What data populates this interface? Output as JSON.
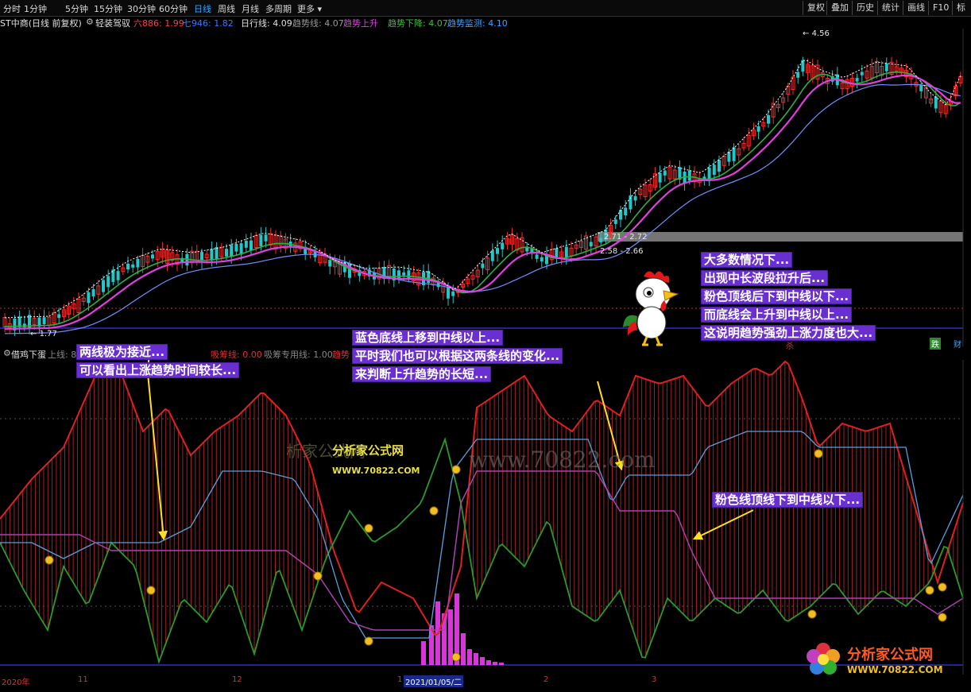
{
  "toolbar": {
    "periods": [
      "分时",
      "1分钟",
      "5分钟",
      "15分钟",
      "30分钟",
      "60分钟",
      "日线",
      "周线",
      "月线",
      "多周期",
      "更多"
    ],
    "active_period": "日线",
    "right_buttons": [
      "复权",
      "叠加",
      "历史",
      "统计",
      "画线",
      "F10",
      "标"
    ]
  },
  "main_info": {
    "stock": "ST中商(日线 前复权)",
    "indicator": "轻装驾驭",
    "six_label": "六886: 1.99",
    "seven_label": "七946: 1.82",
    "day_line": "日行线: 4.09",
    "trend_line": "趋势线: 4.07",
    "trend_up": "趋势上升",
    "trend_down": "趋势下降: 4.07",
    "trend_monitor": "趋势监测: 4.10"
  },
  "price_labels": {
    "high": "4.56",
    "low": "1.77",
    "range1": "2.71 - 2.72",
    "range2": "2.58 - 2.66"
  },
  "sub_info": {
    "name": "借鸡下蛋",
    "upper": "上线: 80",
    "collect": "吸筹线: 0.00",
    "collect_special": "吸筹专用线: 1.00",
    "trend": "趋势"
  },
  "side_labels": {
    "kill": "杀",
    "flat": "跌",
    "wealth": "财"
  },
  "notes": {
    "right_top": [
      "大多数情况下...",
      "出现中长波段拉升后...",
      "粉色顶线后下到中线以下...",
      "而底线会上升到中线以上...",
      "这说明趋势强劲上涨力度也大..."
    ],
    "left": [
      "两线极为接近...",
      "可以看出上涨趋势时间较长..."
    ],
    "middle": [
      "蓝色底线上移到中线以上...",
      "平时我们也可以根据这两条线的变化...",
      "来判断上升趋势的长短..."
    ],
    "right_bottom": [
      "粉色线顶线下到中线以下..."
    ]
  },
  "date_axis": {
    "labels": [
      "2020年",
      "11",
      "12",
      "1",
      "2021/01/05/二",
      "2",
      "3"
    ]
  },
  "watermarks": {
    "cn_small": "分析家公式网",
    "url_small": "WWW.70822.COM",
    "big": "www.70822.com",
    "cn_big": "析家公式网",
    "logo_text": "分析家公式网",
    "logo_url": "WWW.70822.COM"
  },
  "colors": {
    "up": "#ff2a2a",
    "down": "#22c8c8",
    "ma_pink": "#e040e0",
    "ma_green": "#30c040",
    "ma_blue": "#60a0ff",
    "note_bg": "#6a2fd0",
    "arrow": "#ffe020"
  }
}
